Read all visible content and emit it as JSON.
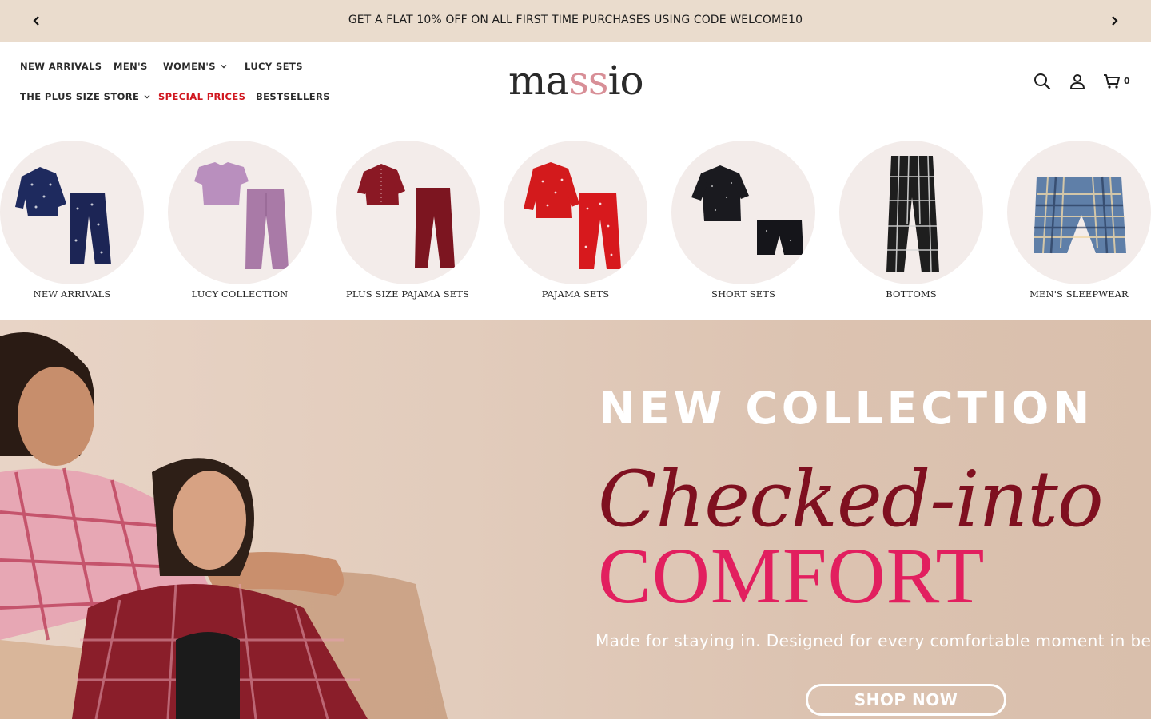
{
  "announcement": {
    "text": "GET A FLAT 10% OFF ON ALL FIRST TIME PURCHASES USING CODE WELCOME10",
    "prev_icon": "chevron-left-icon",
    "next_icon": "chevron-right-icon",
    "background": "#eadccd"
  },
  "nav": {
    "new_arrivals": "NEW ARRIVALS",
    "mens": "MEN'S",
    "womens": "WOMEN'S",
    "lucy_sets": "LUCY SETS",
    "plus_size_store": "THE PLUS SIZE STORE",
    "special_prices": "SPECIAL PRICES",
    "bestsellers": "BESTSELLERS",
    "special_color": "#d0161e"
  },
  "logo": {
    "part1": "ma",
    "part2": "ss",
    "part3": "io",
    "accent": "#d88f97"
  },
  "header_icons": {
    "search": "search-icon",
    "account": "user-icon",
    "cart": "cart-icon",
    "cart_count": "0"
  },
  "categories": [
    {
      "label": "NEW ARRIVALS",
      "icon": "navy-printed-pajama-set"
    },
    {
      "label": "LUCY COLLECTION",
      "icon": "lilac-tee-pajama-set"
    },
    {
      "label": "PLUS SIZE PAJAMA SETS",
      "icon": "maroon-pajama-set"
    },
    {
      "label": "PAJAMA SETS",
      "icon": "red-printed-pajama-set"
    },
    {
      "label": "SHORT SETS",
      "icon": "black-short-set"
    },
    {
      "label": "BOTTOMS",
      "icon": "black-check-pants"
    },
    {
      "label": "MEN'S SLEEPWEAR",
      "icon": "blue-check-shorts"
    }
  ],
  "hero": {
    "kicker": "NEW COLLECTION",
    "script": "Checked-into",
    "headline": "COMFORT",
    "subtext": "Made for staying in. Designed for every comfortable moment in betwe",
    "cta": "SHOP NOW",
    "script_color": "#7f1020",
    "headline_color": "#e21f5f"
  }
}
